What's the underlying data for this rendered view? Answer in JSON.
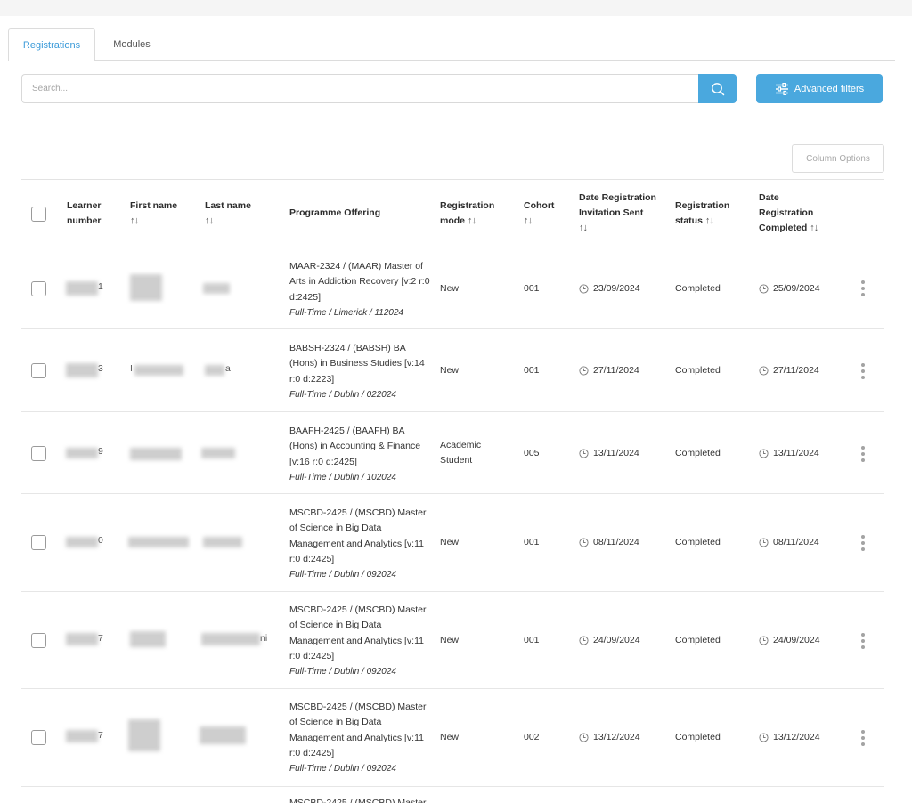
{
  "tabs": {
    "registrations": "Registrations",
    "modules": "Modules"
  },
  "search": {
    "placeholder": "Search..."
  },
  "buttons": {
    "advanced_filters": "Advanced filters",
    "column_options": "Column Options"
  },
  "colors": {
    "accent": "#4aa8de",
    "active_tab": "#3a9ad9"
  },
  "table": {
    "headers": {
      "learner_number": "Learner number",
      "first_name": "First name",
      "last_name": "Last name",
      "programme": "Programme Offering",
      "registration_mode": "Registration mode",
      "cohort": "Cohort",
      "invitation_sent": "Date Registration Invitation Sent",
      "status": "Registration status",
      "completed": "Date Registration Completed"
    },
    "sort_icon": "↑↓",
    "rows": [
      {
        "learner_suffix": "1",
        "first_fragment": "",
        "last_fragment": "",
        "programme": "MAAR-2324 / (MAAR) Master of Arts in Addiction Recovery [v:2 r:0 d:2425]",
        "programme_sub": "Full-Time / Limerick / 112024",
        "mode": "New",
        "cohort": "001",
        "invitation_sent": "23/09/2024",
        "status": "Completed",
        "completed": "25/09/2024"
      },
      {
        "learner_suffix": "3",
        "first_fragment": "I",
        "last_fragment": "a",
        "programme": "BABSH-2324 / (BABSH) BA (Hons) in Business Studies [v:14 r:0 d:2223]",
        "programme_sub": "Full-Time / Dublin / 022024",
        "mode": "New",
        "cohort": "001",
        "invitation_sent": "27/11/2024",
        "status": "Completed",
        "completed": "27/11/2024"
      },
      {
        "learner_suffix": "9",
        "first_fragment": "",
        "last_fragment": "",
        "programme": "BAAFH-2425 / (BAAFH) BA (Hons) in Accounting & Finance [v:16 r:0 d:2425]",
        "programme_sub": "Full-Time / Dublin / 102024",
        "mode": "Academic Student",
        "cohort": "005",
        "invitation_sent": "13/11/2024",
        "status": "Completed",
        "completed": "13/11/2024"
      },
      {
        "learner_suffix": "0",
        "first_fragment": "",
        "last_fragment": "",
        "programme": "MSCBD-2425 / (MSCBD) Master of Science in Big Data Management and Analytics [v:11 r:0 d:2425]",
        "programme_sub": "Full-Time / Dublin / 092024",
        "mode": "New",
        "cohort": "001",
        "invitation_sent": "08/11/2024",
        "status": "Completed",
        "completed": "08/11/2024"
      },
      {
        "learner_suffix": "7",
        "first_fragment": "",
        "last_fragment": "ni",
        "programme": "MSCBD-2425 / (MSCBD) Master of Science in Big Data Management and Analytics [v:11 r:0 d:2425]",
        "programme_sub": "Full-Time / Dublin / 092024",
        "mode": "New",
        "cohort": "001",
        "invitation_sent": "24/09/2024",
        "status": "Completed",
        "completed": "24/09/2024"
      },
      {
        "learner_suffix": "7",
        "first_fragment": "",
        "last_fragment": "",
        "programme": "MSCBD-2425 / (MSCBD) Master of Science in Big Data Management and Analytics [v:11 r:0 d:2425]",
        "programme_sub": "Full-Time / Dublin / 092024",
        "mode": "New",
        "cohort": "002",
        "invitation_sent": "13/12/2024",
        "status": "Completed",
        "completed": "13/12/2024"
      },
      {
        "programme": "MSCBD-2425 / (MSCBD) Master"
      }
    ]
  }
}
